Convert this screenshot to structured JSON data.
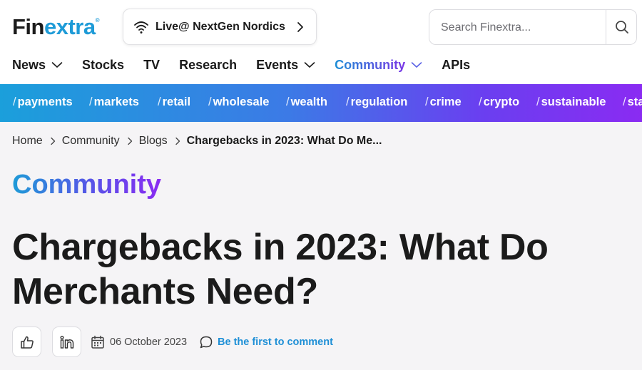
{
  "header": {
    "logo_part1": "Fin",
    "logo_part2": "extra",
    "logo_mark": "®",
    "live_event_label": "Live@ NextGen Nordics",
    "search_placeholder": "Search Finextra..."
  },
  "nav": {
    "items": [
      {
        "label": "News",
        "has_caret": true
      },
      {
        "label": "Stocks",
        "has_caret": false
      },
      {
        "label": "TV",
        "has_caret": false
      },
      {
        "label": "Research",
        "has_caret": false
      },
      {
        "label": "Events",
        "has_caret": true
      },
      {
        "label": "Community",
        "has_caret": true,
        "active": true
      },
      {
        "label": "APIs",
        "has_caret": false
      }
    ]
  },
  "tags": [
    "payments",
    "markets",
    "retail",
    "wholesale",
    "wealth",
    "regulation",
    "crime",
    "crypto",
    "sustainable",
    "sta"
  ],
  "breadcrumb": {
    "items": [
      "Home",
      "Community",
      "Blogs"
    ],
    "current": "Chargebacks in 2023: What Do Me..."
  },
  "section": "Community",
  "article": {
    "title": "Chargebacks in 2023: What Do Merchants Need?",
    "date": "06 October 2023",
    "comment_cta": "Be the first to comment"
  },
  "icons": {
    "live": "wifi-icon",
    "live_arrow": "chevron-right-icon",
    "search": "search-icon",
    "nav_caret": "chevron-down-icon",
    "like": "thumbs-up-icon",
    "share": "linkedin-icon",
    "date": "calendar-icon",
    "comment": "comment-icon"
  },
  "colors": {
    "brand_blue": "#1e9bd7",
    "brand_purple": "#8a2bf2",
    "link_blue": "#1e8fd6"
  }
}
